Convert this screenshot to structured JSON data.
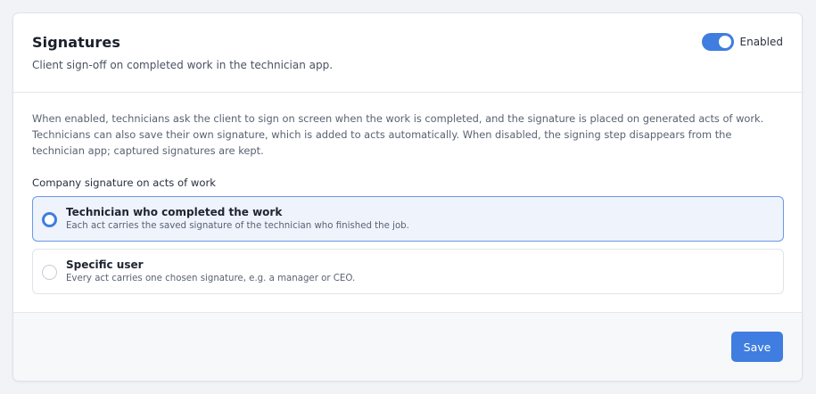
{
  "header": {
    "title": "Signatures",
    "subtitle": "Client sign-off on completed work in the technician app.",
    "toggle_label": "Enabled",
    "toggle_on": true
  },
  "body": {
    "description": "When enabled, technicians ask the client to sign on screen when the work is completed, and the signature is placed on generated acts of work. Technicians can also save their own signature, which is added to acts automatically. When disabled, the signing step disappears from the technician app; captured signatures are kept.",
    "section_label": "Company signature on acts of work",
    "options": [
      {
        "title": "Technician who completed the work",
        "description": "Each act carries the saved signature of the technician who finished the job.",
        "selected": true
      },
      {
        "title": "Specific user",
        "description": "Every act carries one chosen signature, e.g. a manager or CEO.",
        "selected": false
      }
    ]
  },
  "footer": {
    "save_label": "Save"
  },
  "colors": {
    "accent": "#3f7de0",
    "selected_bg": "#eef3fc",
    "page_bg": "#f2f3f6"
  }
}
